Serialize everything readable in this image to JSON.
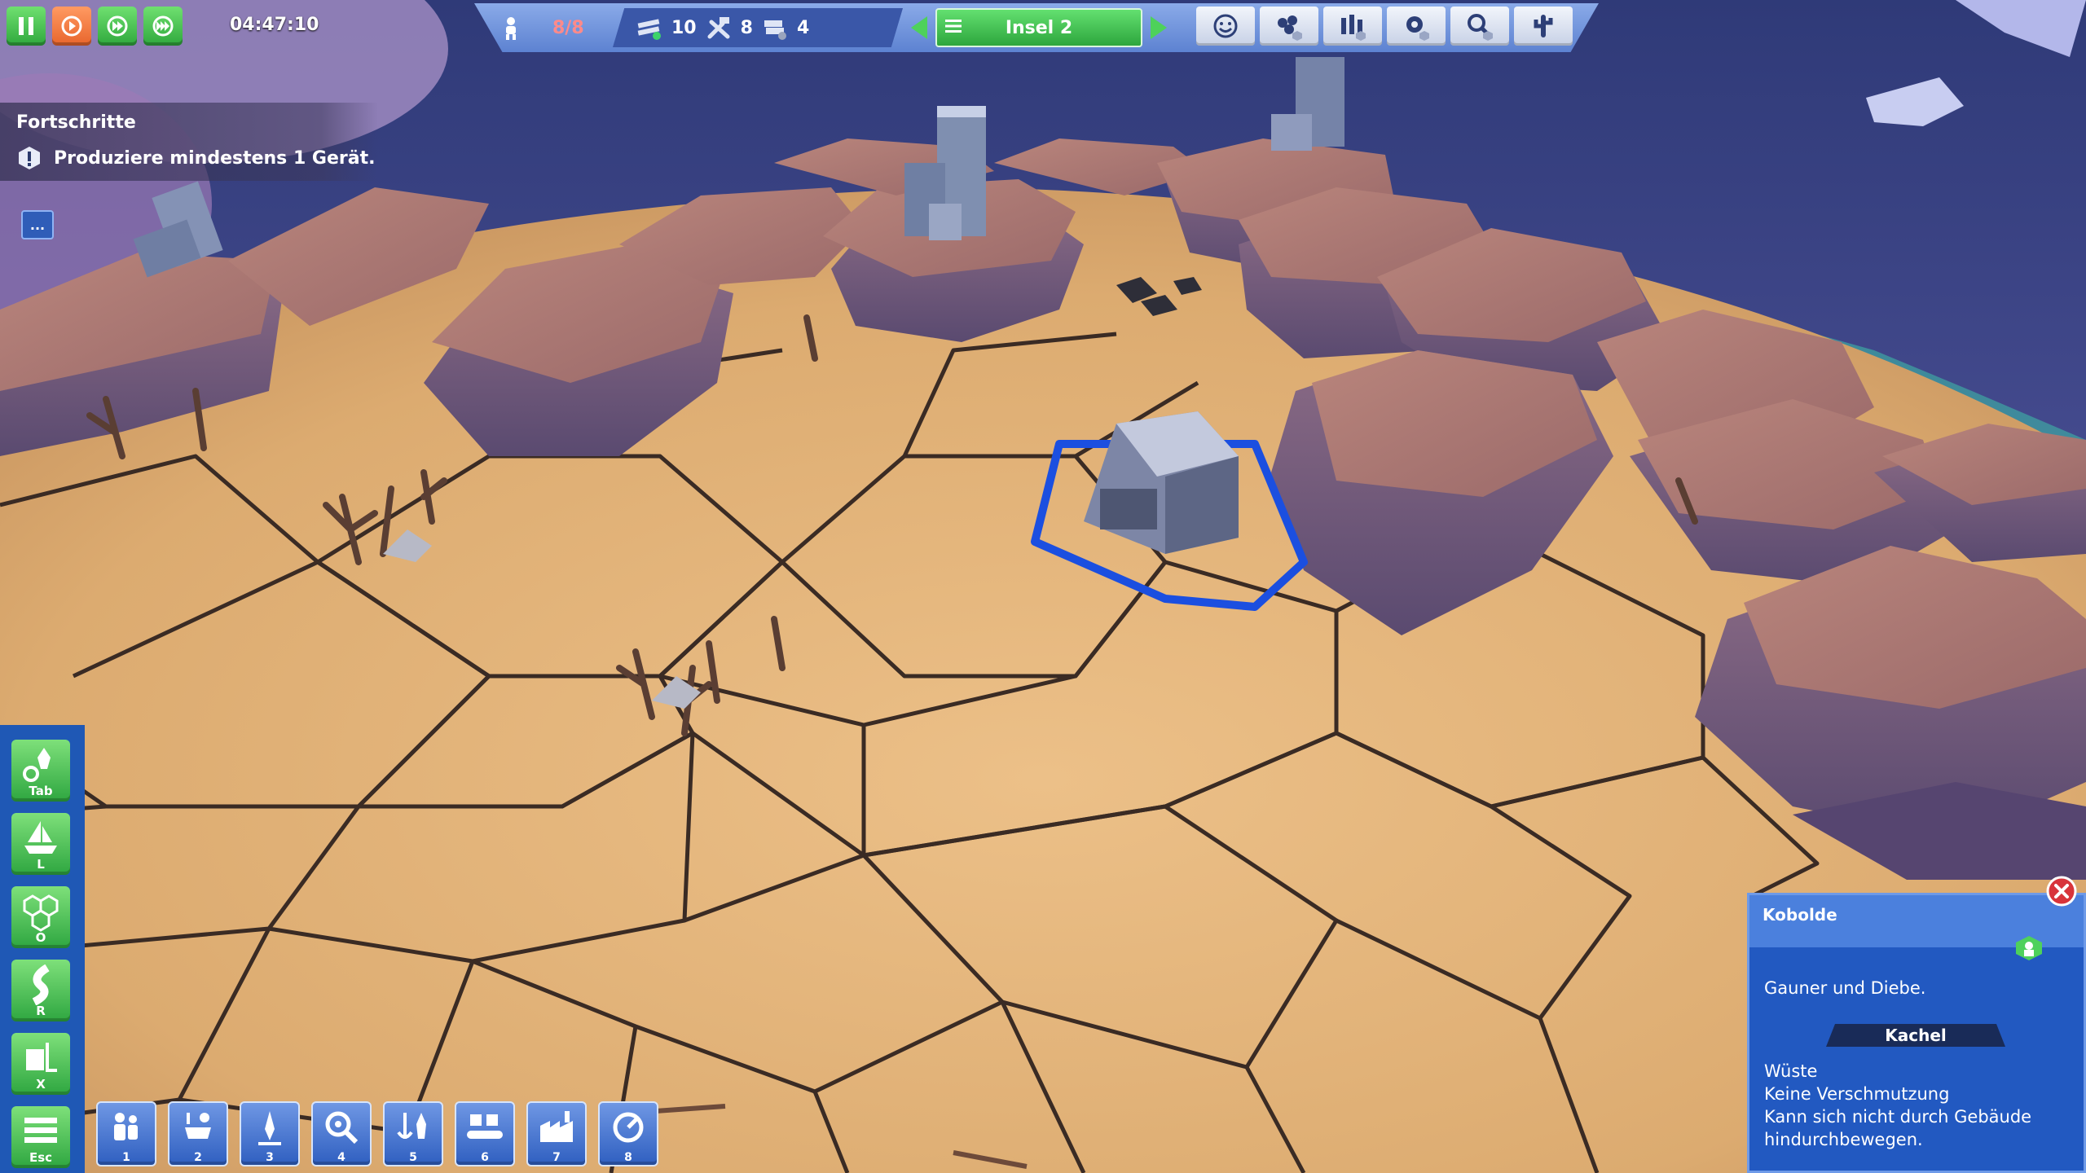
{
  "hud": {
    "time": "04:47:10",
    "population": "8/8",
    "resources": [
      {
        "icon": "planks-icon",
        "value": "10"
      },
      {
        "icon": "tools-icon",
        "value": "8"
      },
      {
        "icon": "metal-icon",
        "value": "4"
      }
    ],
    "island": "Insel 2",
    "speed_buttons": [
      "pause-icon",
      "speed-1-icon",
      "speed-2-icon",
      "speed-3-icon"
    ],
    "tool_buttons": [
      "smiley-icon",
      "resources-icon",
      "workers-icon",
      "gear-icon",
      "research-icon",
      "cactus-icon"
    ]
  },
  "progress": {
    "title": "Fortschritte",
    "task": "Produziere mindestens 1 Gerät.",
    "more": "..."
  },
  "sidebar": [
    {
      "key": "Tab",
      "icon": "rocket-build-icon"
    },
    {
      "key": "L",
      "icon": "ship-icon"
    },
    {
      "key": "O",
      "icon": "hexagons-icon"
    },
    {
      "key": "R",
      "icon": "road-icon"
    },
    {
      "key": "X",
      "icon": "demolish-icon"
    },
    {
      "key": "Esc",
      "icon": "menu-icon"
    }
  ],
  "toolbar": [
    {
      "key": "1",
      "icon": "people-icon"
    },
    {
      "key": "2",
      "icon": "food-icon"
    },
    {
      "key": "3",
      "icon": "drill-icon"
    },
    {
      "key": "4",
      "icon": "gear-search-icon"
    },
    {
      "key": "5",
      "icon": "anchor-rocket-icon"
    },
    {
      "key": "6",
      "icon": "conveyor-icon"
    },
    {
      "key": "7",
      "icon": "factory-icon"
    },
    {
      "key": "8",
      "icon": "dial-icon"
    }
  ],
  "info_panel": {
    "title": "Kobolde",
    "description": "Gauner und Diebe.",
    "section": "Kachel",
    "lines": [
      "Wüste",
      "Keine Verschmutzung",
      "Kann sich nicht durch Gebäude",
      "hindurchbewegen."
    ]
  }
}
